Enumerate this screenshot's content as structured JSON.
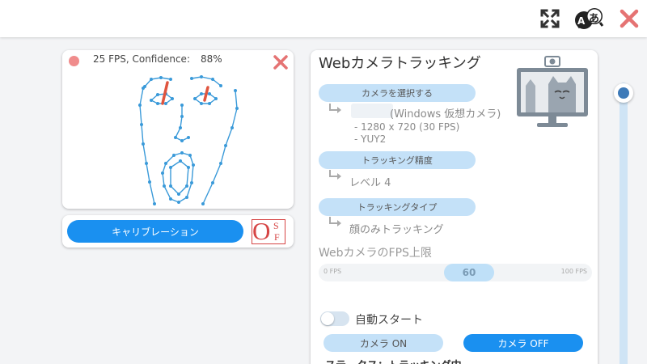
{
  "colors": {
    "primary": "#1a90f0",
    "light_pill": "#c4e1f8",
    "slider_handle": "#bfe0f8",
    "status_red": "#f08c8c",
    "close_red": "#e57373",
    "landmark_blue": "#3a9ad9",
    "gaze_red": "#e0553f",
    "scroll_knob": "#3d7ab8"
  },
  "topbar": {
    "icons": [
      "fullscreen-icon",
      "translate-icon",
      "close-icon"
    ],
    "translate_glyph_a": "A",
    "translate_glyph_jp": "あ"
  },
  "preview": {
    "fps": "25",
    "fps_text": "25 FPS, Confidence:",
    "confidence": "88%"
  },
  "calibration": {
    "button_label": "キャリブレーション",
    "logo_letters": [
      "O",
      "S",
      "F"
    ]
  },
  "settings": {
    "title": "Webカメラトラッキング",
    "select_camera_label": "カメラを選択する",
    "camera_name": "(Windows 仮想カメラ)",
    "camera_resolution": "- 1280 x 720 (30 FPS)",
    "camera_format": "- YUY2",
    "tracking_accuracy_label": "トラッキング精度",
    "tracking_accuracy_value": "レベル 4",
    "tracking_type_label": "トラッキングタイプ",
    "tracking_type_value": "顔のみトラッキング",
    "fps_limit_title": "WebカメラのFPS上限",
    "fps_slider": {
      "min_label": "0 FPS",
      "max_label": "100 FPS",
      "value": "60",
      "min": 0,
      "max": 100
    },
    "auto_start_label": "自動スタート",
    "auto_start_on": false,
    "camera_on_label": "カメラ ON",
    "camera_off_label": "カメラ OFF",
    "status_text": "ステータス：トラッキング中"
  }
}
